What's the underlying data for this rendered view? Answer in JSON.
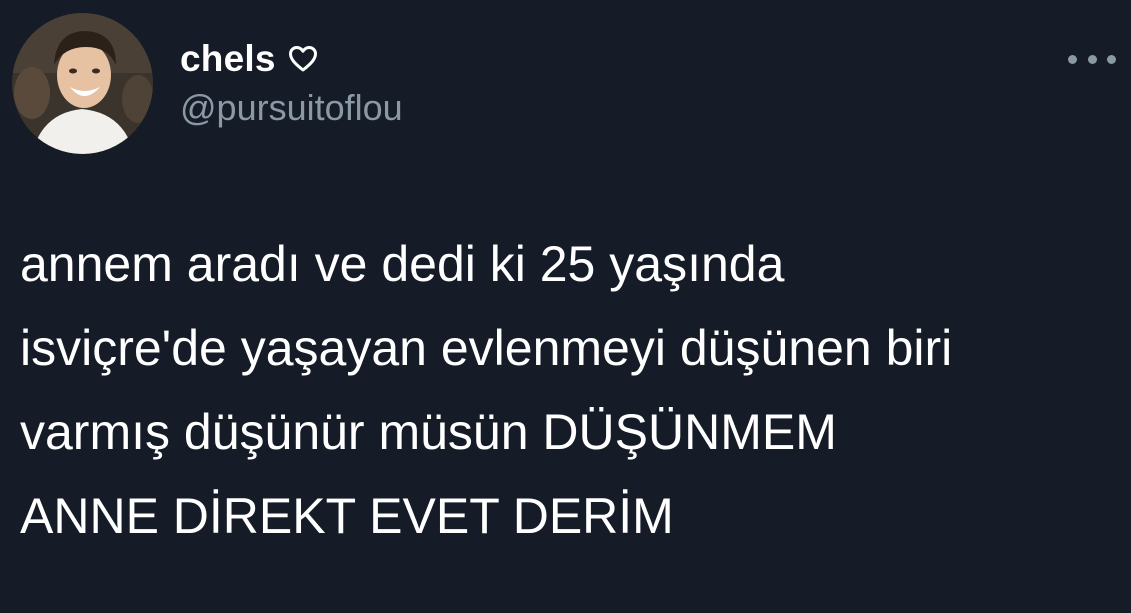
{
  "tweet": {
    "display_name": "chels",
    "name_icon": "heart-outline-icon",
    "handle": "@pursuitoflou",
    "more_icon": "more-horizontal-icon",
    "text_lines": [
      "annem aradı ve dedi ki 25 yaşında",
      "isviçre'de yaşayan evlenmeyi düşünen biri",
      "varmış düşünür müsün DÜŞÜNMEM",
      "ANNE DİREKT EVET DERİM"
    ]
  },
  "colors": {
    "background": "#151b27",
    "primary_text": "#ffffff",
    "secondary_text": "#8b98a5"
  }
}
